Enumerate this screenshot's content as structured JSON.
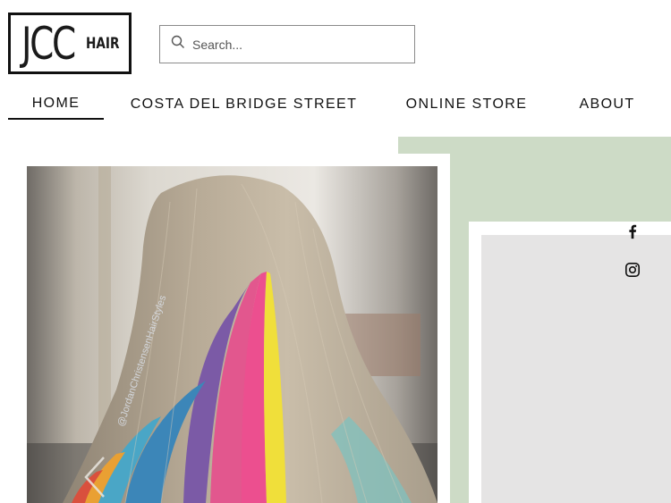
{
  "logo": {
    "main": "JCC",
    "sub": "HAIR"
  },
  "search": {
    "placeholder": "Search..."
  },
  "nav": {
    "items": [
      {
        "label": "HOME",
        "active": true
      },
      {
        "label": "COSTA DEL BRIDGE STREET",
        "active": false
      },
      {
        "label": "ONLINE STORE",
        "active": false
      },
      {
        "label": "ABOUT",
        "active": false
      }
    ]
  },
  "hero": {
    "watermark": "@JordanChristensenHairStyles",
    "prev_icon": "chevron-left-icon"
  },
  "social": {
    "icons": [
      "facebook-icon",
      "instagram-icon"
    ]
  },
  "colors": {
    "green_block": "#cddbc6",
    "panel_gray": "#e5e4e4",
    "text": "#111111"
  }
}
